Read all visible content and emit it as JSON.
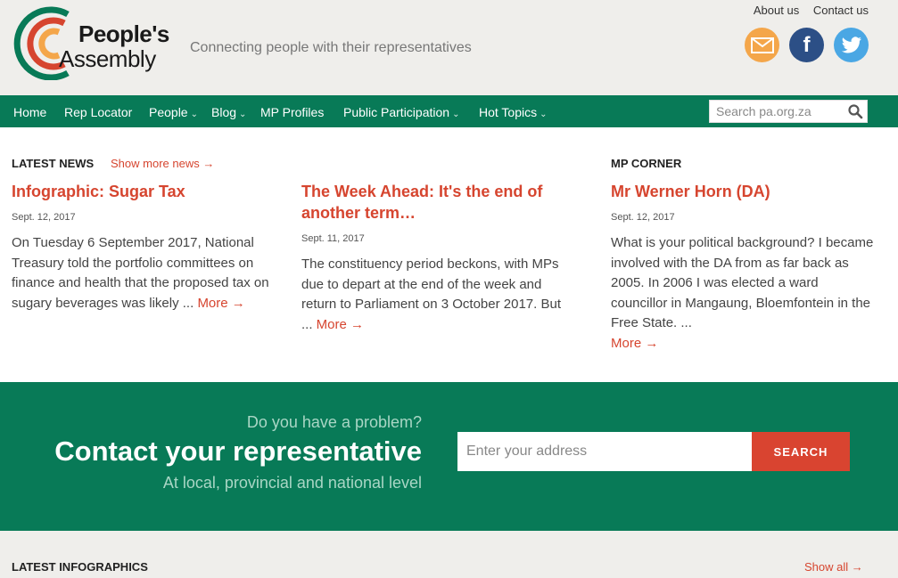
{
  "brand": {
    "name_line1": "People's",
    "name_line2": "Assembly",
    "tagline": "Connecting people with their representatives",
    "colors": {
      "green": "#087a57",
      "red": "#d6452f",
      "orange": "#f4a64a",
      "bg": "#efeeeb"
    }
  },
  "toplinks": [
    "About us",
    "Contact us"
  ],
  "social": [
    {
      "name": "email-icon",
      "glyph": "✉"
    },
    {
      "name": "facebook-icon",
      "glyph": "f"
    },
    {
      "name": "twitter-icon",
      "glyph": "🐦"
    }
  ],
  "nav": {
    "items": [
      {
        "label": "Home",
        "dropdown": false
      },
      {
        "label": "Rep Locator",
        "dropdown": false
      },
      {
        "label": "People",
        "dropdown": true
      },
      {
        "label": "Blog",
        "dropdown": true
      },
      {
        "label": "MP Profiles",
        "dropdown": false
      },
      {
        "label": "Public Participation",
        "dropdown": true
      },
      {
        "label": "Hot Topics",
        "dropdown": true
      }
    ],
    "search_placeholder": "Search pa.org.za"
  },
  "latest_news": {
    "heading": "LATEST NEWS",
    "show_more": "Show more news →",
    "articles": [
      {
        "title": "Infographic: Sugar Tax",
        "date": "Sept. 12, 2017",
        "body": "On Tuesday 6 September 2017, National Treasury told the portfolio committees on finance and health that the proposed tax on sugary beverages was likely ... ",
        "more": "More →"
      },
      {
        "title": "The Week Ahead: It's the end of another term…",
        "date": "Sept. 11, 2017",
        "body": "The constituency period beckons, with MPs due to depart at the end of the week and return to Parliament on 3 October 2017. But ... ",
        "more": "More →"
      }
    ]
  },
  "mp_corner": {
    "heading": "MP CORNER",
    "title": "Mr Werner Horn (DA)",
    "date": "Sept. 12, 2017",
    "body": "What is your political background? I became involved with the DA from as far back as 2005. In 2006 I was elected a ward councillor in Mangaung, Bloemfontein in the Free State. ...",
    "more": "More →"
  },
  "cta": {
    "question": "Do you have a problem?",
    "title": "Contact your representative",
    "subtitle": "At local, provincial and national level",
    "input_placeholder": "Enter your address",
    "button": "SEARCH"
  },
  "infographics": {
    "heading": "LATEST INFOGRAPHICS",
    "show_all": "Show all →"
  }
}
